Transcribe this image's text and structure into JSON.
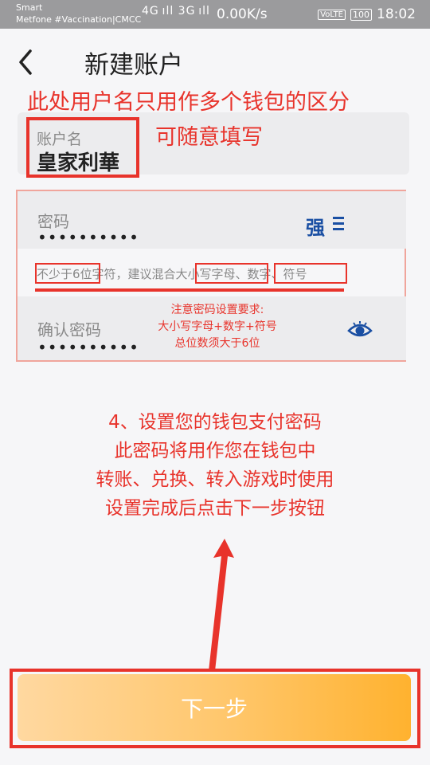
{
  "status_bar": {
    "carrier_line1": "Smart",
    "carrier_line2": "Metfone #Vaccination|CMCC",
    "signal_text": "4G ıll 3G ıll",
    "network_speed": "0.00K/s",
    "volte_badge": "VoLTE",
    "battery": "100",
    "time": "18:02"
  },
  "header": {
    "back_icon": "chevron-left-icon",
    "title": "新建账户"
  },
  "annotations": {
    "top_line1": "此处用户名只用作多个钱包的区分",
    "top_line2": "可随意填写",
    "password_requirement": [
      "注意密码设置要求:",
      "大小写字母+数字+符号",
      "总位数须大于6位"
    ],
    "instructions": [
      "4、设置您的钱包支付密码",
      "此密码将用作您在钱包中",
      "转账、兑换、转入游戏时使用",
      "设置完成后点击下一步按钮"
    ]
  },
  "account": {
    "label": "账户名",
    "value": "皇家利華"
  },
  "password": {
    "label": "密码",
    "masked_value": "••••••••••",
    "strength": "强",
    "strength_icon": "menu-lines-icon",
    "hint": "不少于6位字符，建议混合大小写字母、数字、符号"
  },
  "confirm_password": {
    "label": "确认密码",
    "masked_value": "••••••••••",
    "visibility_icon": "eye-icon"
  },
  "next_button": {
    "label": "下一步"
  },
  "colors": {
    "annotation_red": "#e8332b",
    "strength_blue": "#1a4fa3",
    "button_gradient_start": "#ffd8a0",
    "button_gradient_end": "#ffb22f"
  }
}
